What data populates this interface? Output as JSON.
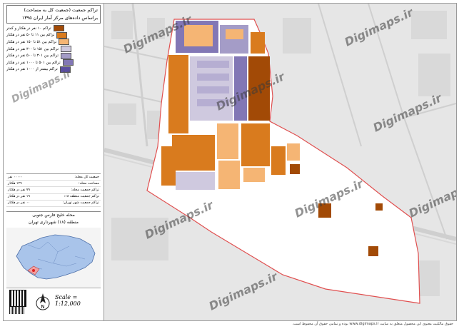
{
  "header": {
    "title_line1": "تراکم جمعیت (جمعیت کل به مساحت)",
    "title_line2": "براساس داده‌های مرکز آمار ایران ۱۳۹۵"
  },
  "legend": {
    "items": [
      {
        "label": "تراکم ۱۰ نفر در هکتار و کمتر",
        "color": "#a24a06"
      },
      {
        "label": "تراکم بین ۱۱ تا ۵۰ نفر در هکتار",
        "color": "#d97b1e"
      },
      {
        "label": "تراکم بین ۵۱ تا ۱۵۰ نفر در هکتار",
        "color": "#f5b574"
      },
      {
        "label": "تراکم بین ۱۵۱ تا ۳۰۰ نفر در هکتار",
        "color": "#cfc9df"
      },
      {
        "label": "تراکم بین ۳۰۱ تا ۵۰۰ نفر در هکتار",
        "color": "#a49cc7"
      },
      {
        "label": "تراکم بین ۵۰۱ تا ۱۰۰۰ نفر در هکتار",
        "color": "#8277b5"
      },
      {
        "label": "تراکم بیشتر از ۱۰۰۰ نفر در هکتار",
        "color": "#5b4ea0"
      }
    ]
  },
  "stats": [
    {
      "key": "جمعیت کل محله:",
      "value": "۰۰۰۰۰ نفر"
    },
    {
      "key": "مساحت محله:",
      "value": "۱۲۹ هکتار"
    },
    {
      "key": "تراکم جمعیت محله:",
      "value": "۷۹ نفر در هکتار"
    },
    {
      "key": "تراکم جمعیت منطقه ۱۸:",
      "value": "۱۹ نفر در هکتار"
    },
    {
      "key": "تراکم جمعیت شهر تهران:",
      "value": "۰۰ نفر در هکتار"
    }
  ],
  "region": {
    "line1": "محله خلیج فارس جنوبی",
    "line2": "منطقه (۱۸) شهرداری تهران"
  },
  "scale_text": "Scale = 1:12,000",
  "north_label": "N",
  "watermark": "Digimaps.ir",
  "footer_note": "حقوق مالکیت معنوی این محصول متعلق به سایت www.digimaps.ir بوده و تمامی حقوق آن محفوظ است.",
  "colors": {
    "basemap": "#e4e4e4",
    "road": "#cfcfcf",
    "boundary": "#e05050"
  }
}
